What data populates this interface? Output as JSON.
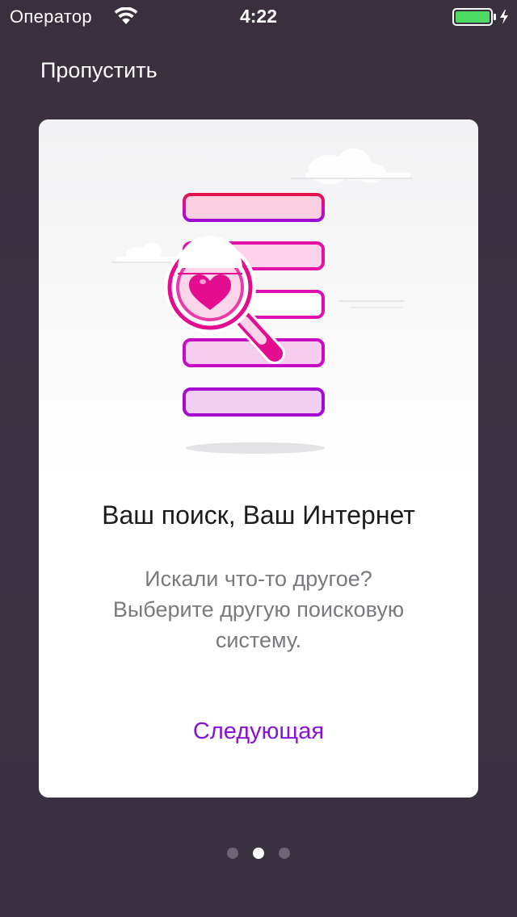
{
  "status_bar": {
    "carrier": "Оператор",
    "time": "4:22",
    "wifi_icon": "wifi-icon",
    "battery_icon": "battery-charging-icon",
    "battery_color": "#4cd964"
  },
  "header": {
    "skip_label": "Пропустить"
  },
  "card": {
    "illustration_icon": "search-list-heart-magnifier-illustration",
    "title": "Ваш поиск, Ваш Интернет",
    "body_lines": [
      "Искали что-то другое?",
      "Выберите другую поисковую",
      "систему."
    ],
    "next_label": "Следующая"
  },
  "pagination": {
    "total": 3,
    "current": 2
  },
  "colors": {
    "accent": "#8a12d6",
    "magenta": "#e40c8f",
    "background": "#3b3140"
  }
}
